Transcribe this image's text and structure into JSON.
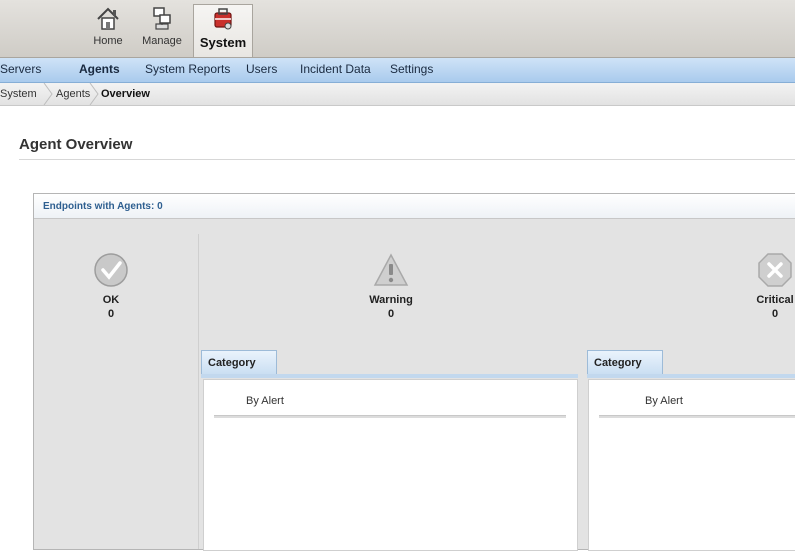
{
  "toolbar": {
    "items": [
      {
        "label": "Home",
        "icon": "home-icon"
      },
      {
        "label": "Manage",
        "icon": "manage-icon"
      },
      {
        "label": "System",
        "icon": "system-icon",
        "active": true
      }
    ]
  },
  "nav": {
    "items": [
      {
        "label": "Servers"
      },
      {
        "label": "Agents",
        "active": true
      },
      {
        "label": "System Reports"
      },
      {
        "label": "Users"
      },
      {
        "label": "Incident Data"
      },
      {
        "label": "Settings"
      }
    ]
  },
  "breadcrumb": {
    "items": [
      "System",
      "Agents",
      "Overview"
    ]
  },
  "page": {
    "title": "Agent Overview"
  },
  "panel": {
    "header": "Endpoints with Agents: 0",
    "statuses": [
      {
        "label": "OK",
        "count": "0",
        "icon": "check-icon"
      },
      {
        "label": "Warning",
        "count": "0",
        "icon": "warning-icon"
      },
      {
        "label": "Critical",
        "count": "0",
        "icon": "critical-icon"
      }
    ],
    "category_tabs": [
      {
        "label": "Category",
        "row": "By Alert"
      },
      {
        "label": "Category",
        "row": "By Alert"
      }
    ]
  },
  "colors": {
    "nav_bg": "#b9d4f0",
    "panel_header_text": "#2e5f90",
    "panel_bg": "#e3e3e3"
  }
}
